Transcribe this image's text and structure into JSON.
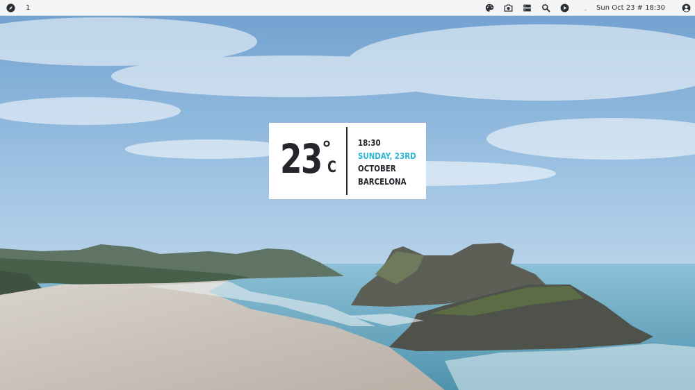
{
  "topbar": {
    "workspace": "1",
    "left_icon": "compass-icon",
    "right_icons": [
      "palette-icon",
      "camera-icon",
      "server-icon",
      "search-icon",
      "play-icon"
    ],
    "clock": "Sun Oct 23 # 18:30",
    "user_icon": "user-circle-icon"
  },
  "widget": {
    "temperature": "23",
    "degree_symbol": "°",
    "unit": "C",
    "time": "18:30",
    "day": "SUNDAY, 23RD",
    "month": "OCTOBER",
    "city": "BARCELONA",
    "accent_color": "#2bb6d3",
    "text_color": "#24262b"
  },
  "colors": {
    "topbar_bg": "#f4f5f6",
    "sky": "#8fb9dc",
    "sea": "#6fa9bf",
    "sand": "#cfc8c0"
  }
}
